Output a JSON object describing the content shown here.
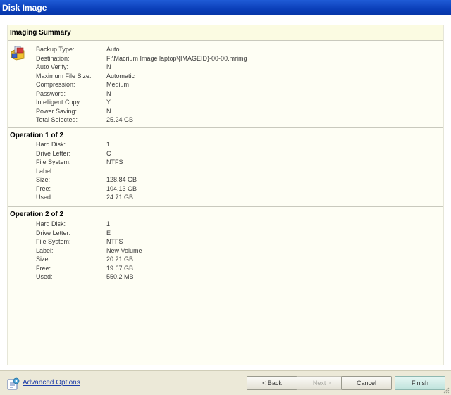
{
  "window": {
    "title": "Disk Image"
  },
  "summary": {
    "header": "Imaging Summary",
    "rows": [
      {
        "label": "Backup Type:",
        "value": "Auto"
      },
      {
        "label": "Destination:",
        "value": "F:\\Macrium Image laptop\\{IMAGEID}-00-00.mrimg"
      },
      {
        "label": "Auto Verify:",
        "value": "N"
      },
      {
        "label": "Maximum File Size:",
        "value": "Automatic"
      },
      {
        "label": "Compression:",
        "value": "Medium"
      },
      {
        "label": "Password:",
        "value": "N"
      },
      {
        "label": "Intelligent Copy:",
        "value": "Y"
      },
      {
        "label": "Power Saving:",
        "value": "N"
      },
      {
        "label": "Total Selected:",
        "value": "25.24 GB"
      }
    ]
  },
  "operations": [
    {
      "header": "Operation 1 of 2",
      "rows": [
        {
          "label": "Hard Disk:",
          "value": "1"
        },
        {
          "label": "Drive Letter:",
          "value": "C"
        },
        {
          "label": "File System:",
          "value": "NTFS"
        },
        {
          "label": "Label:",
          "value": ""
        },
        {
          "label": "Size:",
          "value": "128.84 GB"
        },
        {
          "label": "Free:",
          "value": "104.13 GB"
        },
        {
          "label": "Used:",
          "value": "24.71 GB"
        }
      ]
    },
    {
      "header": "Operation 2 of 2",
      "rows": [
        {
          "label": "Hard Disk:",
          "value": "1"
        },
        {
          "label": "Drive Letter:",
          "value": "E"
        },
        {
          "label": "File System:",
          "value": "NTFS"
        },
        {
          "label": "Label:",
          "value": "New Volume"
        },
        {
          "label": "Size:",
          "value": "20.21 GB"
        },
        {
          "label": "Free:",
          "value": "19.67 GB"
        },
        {
          "label": "Used:",
          "value": "550.2 MB"
        }
      ]
    }
  ],
  "footer": {
    "advanced_options": "Advanced Options",
    "back": "< Back",
    "next": "Next >",
    "cancel": "Cancel",
    "finish": "Finish"
  },
  "icons": {
    "summary": "disk-image-icon",
    "advanced": "advanced-options-icon",
    "grip": "resize-grip-icon"
  }
}
